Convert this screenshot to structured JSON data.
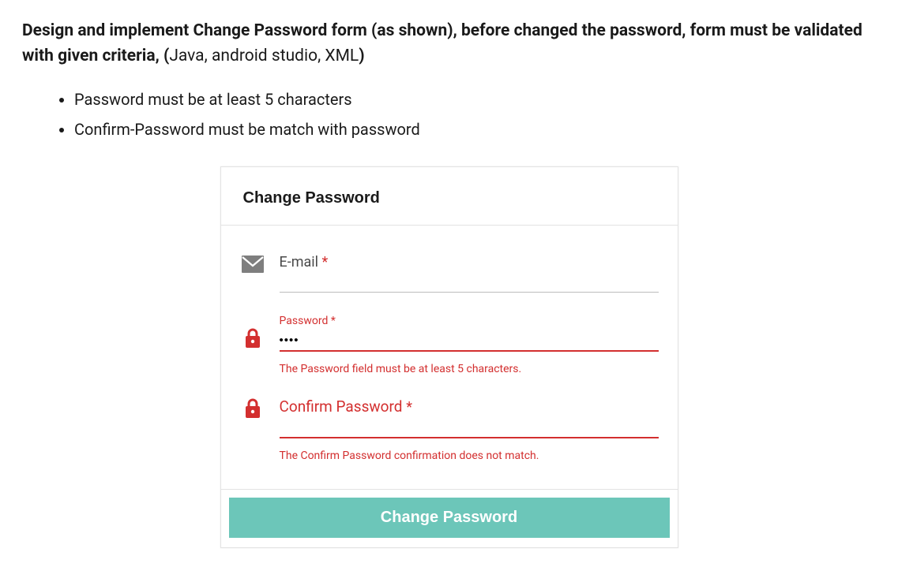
{
  "doc": {
    "title_bold_1": "Design and implement Change Password form (as shown), before changed the password, form must be validated with given criteria, (",
    "title_plain": "Java, android studio, XML",
    "title_bold_2": ")",
    "bullets": [
      "Password must be at least 5 characters",
      "Confirm-Password must be match with password"
    ]
  },
  "form": {
    "header_title": "Change Password",
    "email": {
      "label": "E-mail",
      "required_marker": "*",
      "value": ""
    },
    "password": {
      "label_small": "Password",
      "required_marker": "*",
      "value": "••••",
      "error_text": "The Password field must be at least 5 characters."
    },
    "confirm": {
      "label": "Confirm Password",
      "required_marker": "*",
      "value": "",
      "error_text": "The Confirm Password confirmation does not match."
    },
    "submit_label": "Change Password"
  },
  "colors": {
    "error": "#d32f2f",
    "button": "#6cc6b9"
  }
}
